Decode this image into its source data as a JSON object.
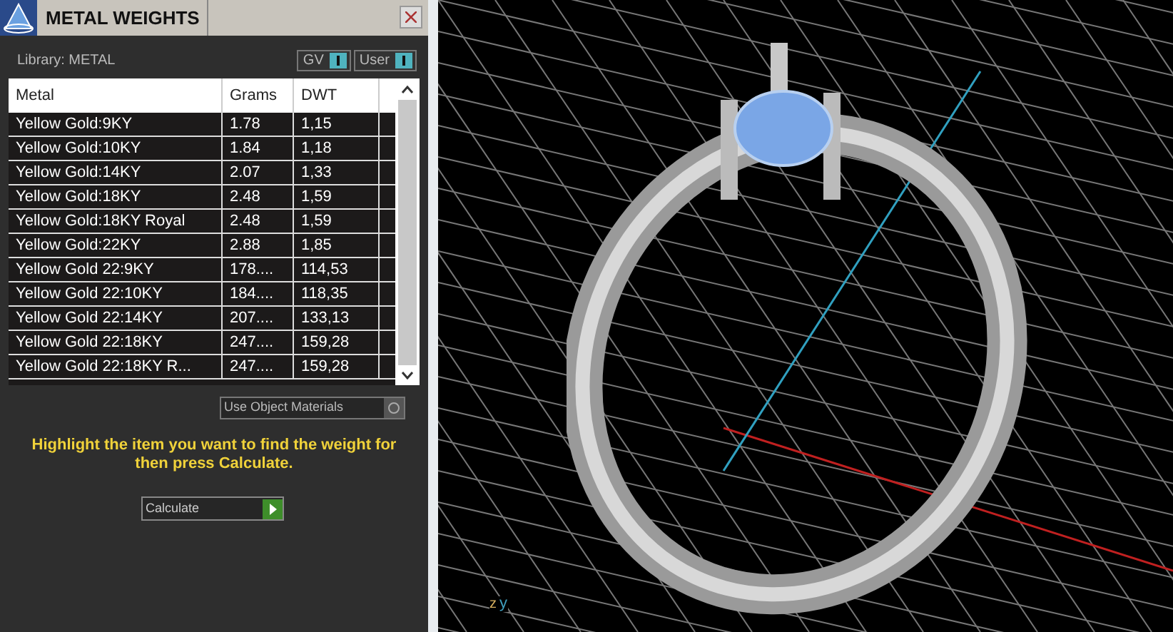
{
  "panel": {
    "title": "METAL WEIGHTS",
    "library": "Library: METAL",
    "toggles": [
      {
        "label": "GV",
        "on": true
      },
      {
        "label": "User",
        "on": true
      }
    ]
  },
  "table": {
    "columns": [
      "Metal",
      "Grams",
      "DWT"
    ],
    "rows": [
      {
        "metal": "Yellow Gold:9KY",
        "grams": "1.78",
        "dwt": "1,15"
      },
      {
        "metal": "Yellow Gold:10KY",
        "grams": "1.84",
        "dwt": "1,18"
      },
      {
        "metal": "Yellow Gold:14KY",
        "grams": "2.07",
        "dwt": "1,33"
      },
      {
        "metal": "Yellow Gold:18KY",
        "grams": "2.48",
        "dwt": "1,59"
      },
      {
        "metal": "Yellow Gold:18KY Royal",
        "grams": "2.48",
        "dwt": "1,59"
      },
      {
        "metal": "Yellow Gold:22KY",
        "grams": "2.88",
        "dwt": "1,85"
      },
      {
        "metal": "Yellow Gold 22:9KY",
        "grams": "178....",
        "dwt": "114,53"
      },
      {
        "metal": "Yellow Gold 22:10KY",
        "grams": "184....",
        "dwt": "118,35"
      },
      {
        "metal": "Yellow Gold 22:14KY",
        "grams": "207....",
        "dwt": "133,13"
      },
      {
        "metal": "Yellow Gold 22:18KY",
        "grams": "247....",
        "dwt": "159,28"
      },
      {
        "metal": "Yellow Gold 22:18KY R...",
        "grams": "247....",
        "dwt": "159,28"
      }
    ]
  },
  "use_object_materials": {
    "label": "Use Object Materials",
    "on": false
  },
  "instruction": "Highlight the item you want to find the weight for then press Calculate.",
  "calculate_button": "Calculate",
  "viewport": {
    "axes": [
      "z",
      "y"
    ]
  }
}
